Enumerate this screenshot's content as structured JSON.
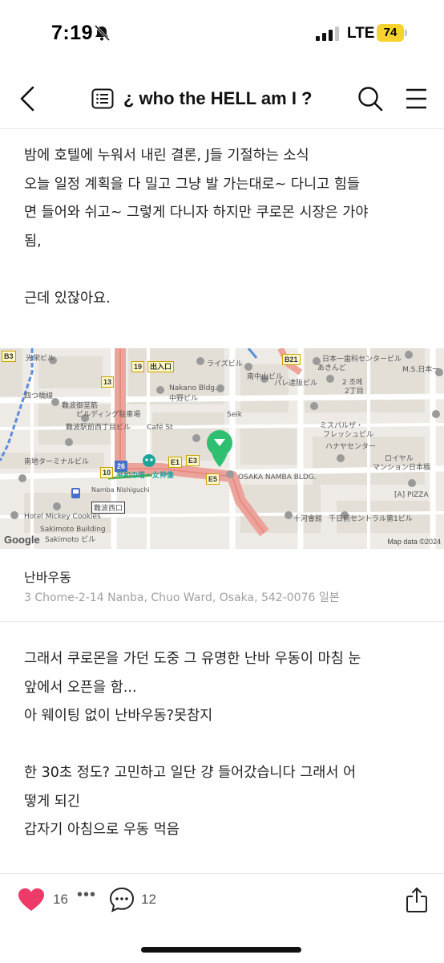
{
  "status_bar": {
    "time": "7:19",
    "network": "LTE",
    "battery_level": "74",
    "battery_color": "#f5d22c"
  },
  "header": {
    "title": "¿ who the HELL am I ?",
    "icons": [
      "back-arrow-icon",
      "list-icon",
      "search-icon",
      "menu-icon"
    ]
  },
  "post": {
    "paragraph1": [
      "밤에 호텔에 누워서 내린 결론, J들 기절하는 소식",
      "오늘 일정 계획을 다 밀고 그냥 발 가는대로~ 다니고 힘들",
      "면 들어와 쉬고~ 그렇게 다니자 하지만 쿠로몬 시장은 가야",
      "됨,",
      "",
      "근데 있잖아요."
    ],
    "paragraph2": [
      "그래서 쿠로몬을 가던 도중 그 유명한 난바 우동이 마침 눈",
      "앞에서 오픈을 함...",
      "아 웨이팅 없이 난바우동?못참지",
      "",
      "한 30초 정도? 고민하고 일단 걍 들어갔습니다 그래서 어",
      "떻게 되긴",
      "갑자기 아침으로 우동 먹음"
    ]
  },
  "map": {
    "labels": {
      "b3": "B3",
      "kouei": "光栄ビル",
      "b21": "B21",
      "nihon_ichi": "日本一歯科センタービル",
      "akinde": "あきんど",
      "ms": "M.S.日本一",
      "n13": "13",
      "n19": "19",
      "exit": "出入口",
      "raizu": "ライズビル",
      "nakano": "Nakano Bldg.",
      "nakano_jp": "中野ビル",
      "minami_naka": "南中山ビル",
      "palle": "パレ達阪ビル",
      "chome": "2 조메",
      "chome2": "2丁目",
      "namba_goshu": "難波御堂筋",
      "building_parking": "ビルディング駐車場",
      "namba_station_nishi": "難波駅前西丁目ビル",
      "cafe": "Café St",
      "seik": "Seik",
      "mispal": "ミスパルザ・",
      "fresh": "フレッシュビル",
      "hanaha": "ハナヤセンター",
      "yotsubashi": "四つ橋線",
      "minami_terminal": "南地ターミナルビル",
      "n26": "26",
      "heiwa": "平和の塔・女神像",
      "e1": "E1",
      "e3": "E3",
      "e5": "E5",
      "royal": "ロイヤル",
      "royal2": "マンション日本橋",
      "n10": "10",
      "osaka_namba": "OSAKA NAMBA BLDG.",
      "pizza": "[A] PIZZA",
      "namba_nishiguchi": "Namba Nishiguchi",
      "namba_nishiguchi_jp": "難波西口",
      "mickey": "Hotel Mickey Cookies",
      "sakimoto": "Sakimoto Building",
      "sakimoto2": "Sakimoto ビル",
      "jukou": "十河會館",
      "sennichimae": "千日前セントラル第1ビル",
      "logo": "Google",
      "attribution": "Map data ©2024"
    }
  },
  "place": {
    "name": "난바우동",
    "address": "3 Chome-2-14 Nanba, Chuo Ward, Osaka, 542-0076 일본"
  },
  "actions": {
    "like_count": "16",
    "more": "•••",
    "comment_count": "12",
    "heart_color": "#ee3a68"
  }
}
